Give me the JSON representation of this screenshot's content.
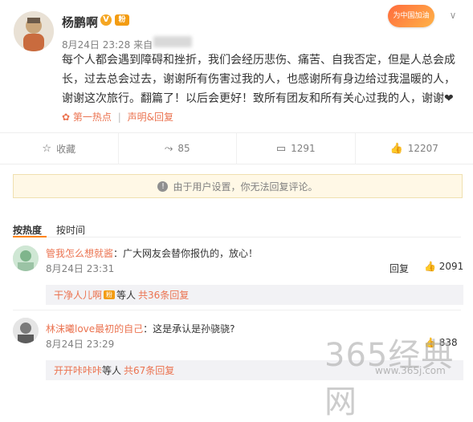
{
  "post": {
    "username": "杨鹏啊",
    "meta_time": "8月24日 23:28 来自",
    "content": "每个人都会遇到障碍和挫折，我们会经历悲伤、痛苦、自我否定，但是人总会成长，过去总会过去，谢谢所有伤害过我的人，也感谢所有身边给过我温暖的人，谢谢这次旅行。翻篇了！以后会更好！致所有团友和所有关心过我的人，谢谢❤",
    "tag_link": "第一热点",
    "tag_sep": "|",
    "tag_appeal": "声明&回复"
  },
  "badges": {
    "banner": "为中国加油",
    "chevron": "∨",
    "v": "V",
    "fan": "粉"
  },
  "actions": [
    {
      "icon": "star-icon",
      "label": "收藏"
    },
    {
      "icon": "share-icon",
      "label": "85"
    },
    {
      "icon": "comment-icon",
      "label": "1291"
    },
    {
      "icon": "like-icon",
      "label": "12207"
    }
  ],
  "notice": "由于用户设置，你无法回复评论。",
  "sort": {
    "by_hot": "按热度",
    "by_time": "按时间"
  },
  "comments": [
    {
      "name": "管我怎么想就酱",
      "text": "：广大网友会替你报仇的，放心！",
      "time": "8月24日 23:31",
      "reply": "回复",
      "likes": "2091",
      "sub_name": "干净人儿啊",
      "sub_mid": "等人",
      "sub_count": "共36条回复"
    },
    {
      "name": "林沫曦love最初的自己",
      "text": "：这是承认是孙骁骁?",
      "time": "8月24日 23:29",
      "likes": "838",
      "sub_name": "开开咔咔咔",
      "sub_mid": "等人",
      "sub_count": "共67条回复"
    }
  ],
  "watermark": {
    "main": "365经典网",
    "url": "www.365j.com"
  }
}
